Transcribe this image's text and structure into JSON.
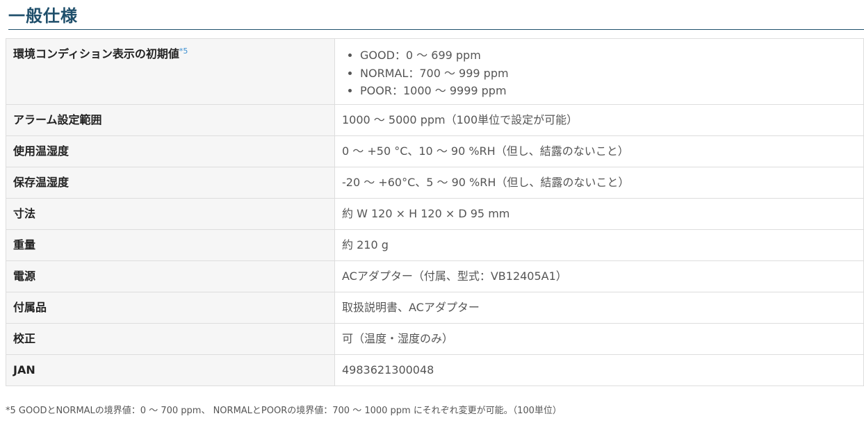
{
  "heading": "一般仕様",
  "table": {
    "rows": [
      {
        "label": "環境コンディション表示の初期値",
        "note_ref": "*5",
        "items": [
          "GOOD：0 ～ 699 ppm",
          "NORMAL：700 ～ 999 ppm",
          "POOR：1000 ～ 9999 ppm"
        ]
      },
      {
        "label": "アラーム設定範囲",
        "value": "1000 ～ 5000 ppm（100単位で設定が可能）"
      },
      {
        "label": "使用温湿度",
        "value": "0 ～ +50 °C、10 ～ 90 %RH（但し、結露のないこと）"
      },
      {
        "label": "保存温湿度",
        "value": "-20 ～ +60°C、5 ～ 90 %RH（但し、結露のないこと）"
      },
      {
        "label": "寸法",
        "value": "約 W 120 × H 120 × D 95 mm"
      },
      {
        "label": "重量",
        "value": "約 210 g"
      },
      {
        "label": "電源",
        "value": "ACアダプター（付属、型式：VB12405A1）"
      },
      {
        "label": "付属品",
        "value": "取扱説明書、ACアダプター"
      },
      {
        "label": "校正",
        "value": "可（温度・湿度のみ）"
      },
      {
        "label": "JAN",
        "value": "4983621300048"
      }
    ]
  },
  "footnote": "*5 GOODとNORMALの境界値：0 ～ 700 ppm、 NORMALとPOORの境界値：700 ～ 1000 ppm にそれぞれ変更が可能。（100単位）",
  "colors": {
    "heading": "#1f4f6b",
    "label_background": "#f6f6f6",
    "border": "#dddddd",
    "note_ref": "#3c8fd0"
  }
}
